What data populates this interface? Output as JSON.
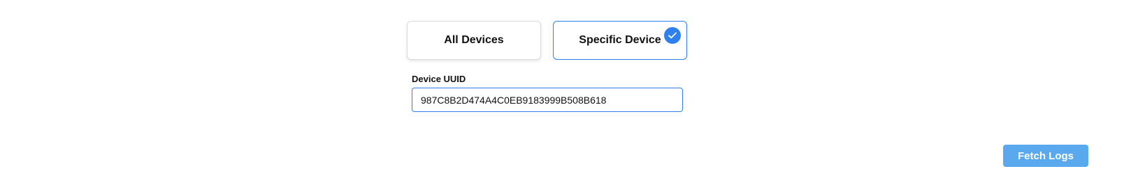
{
  "scope_options": {
    "all_devices": {
      "label": "All Devices",
      "selected": false
    },
    "specific_device": {
      "label": "Specific Device",
      "selected": true
    }
  },
  "device_field": {
    "label": "Device UUID",
    "value": "987C8B2D474A4C0EB9183999B508B618"
  },
  "actions": {
    "fetch_label": "Fetch Logs"
  },
  "colors": {
    "accent": "#2f80ed",
    "button": "#5aa9ef",
    "card_border": "#d8dbe0"
  },
  "icons": {
    "selected": "checkmark-icon"
  }
}
